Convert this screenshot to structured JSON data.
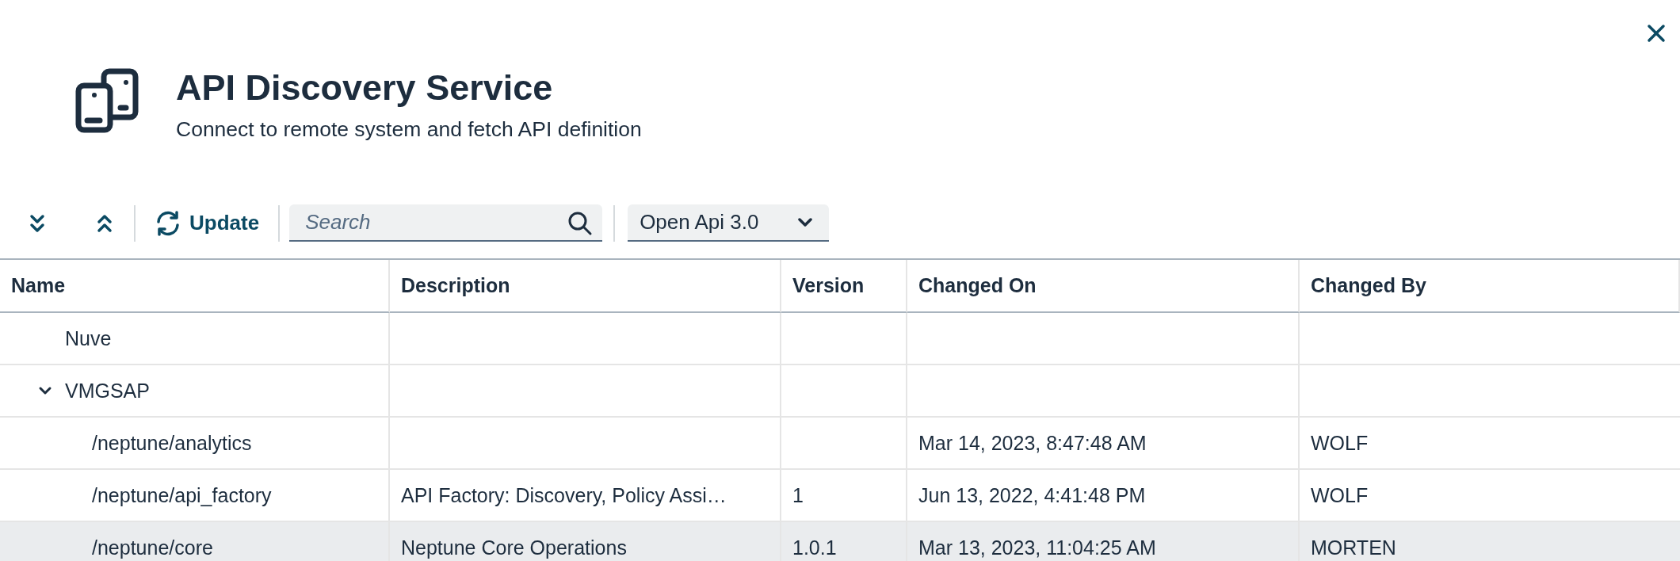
{
  "dialog": {
    "title": "API Discovery Service",
    "subtitle": "Connect to remote system and fetch API definition"
  },
  "toolbar": {
    "update_label": "Update",
    "search": {
      "placeholder": "Search"
    },
    "format_select": {
      "value": "Open Api 3.0"
    }
  },
  "table": {
    "columns": [
      "Name",
      "Description",
      "Version",
      "Changed On",
      "Changed By"
    ],
    "rows": [
      {
        "name": "Nuve",
        "selected": false
      },
      {
        "name": "VMGSAP",
        "selected": false,
        "expanded": true,
        "children": [
          {
            "name": "/neptune/analytics",
            "changed_on": "Mar 14, 2023, 8:47:48 AM",
            "changed_by": "WOLF",
            "selected": false
          },
          {
            "name": "/neptune/api_factory",
            "description": "API Factory: Discovery, Policy Assi…",
            "version": "1",
            "changed_on": "Jun 13, 2022, 4:41:48 PM",
            "changed_by": "WOLF",
            "selected": false
          },
          {
            "name": "/neptune/core",
            "description": "Neptune Core Operations",
            "version": "1.0.1",
            "changed_on": "Mar 13, 2023, 11:04:25 AM",
            "changed_by": "MORTEN",
            "selected": true
          }
        ]
      }
    ]
  }
}
